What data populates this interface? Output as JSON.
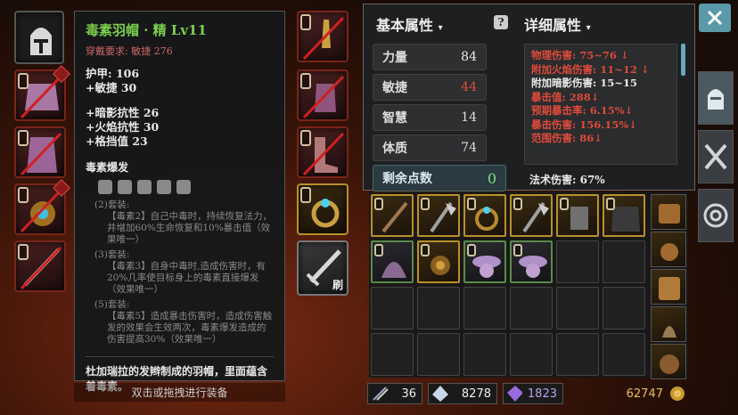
{
  "tooltip": {
    "title": "毒素羽帽 · 精 Lv11",
    "requirement": "穿戴要求: 敏捷 276",
    "armor": "护甲: 106",
    "agi_bonus": "+敏捷 30",
    "res_shadow": "+暗影抗性 26",
    "res_fire": "+火焰抗性 30",
    "block": "+格挡值 23",
    "set_name": "毒素爆发",
    "set2_head": "(2)套装:",
    "set2_text": "【毒素2】自己中毒时，持续恢复法力，并增加60%生命恢复和10%暴击值（效果唯一）",
    "set3_head": "(3)套装:",
    "set3_text": "【毒素3】自身中毒时,造成伤害时，有20%几率使目标身上的毒素直接爆发（效果唯一）",
    "set5_head": "(5)套装:",
    "set5_text": "【毒素5】造成暴击伤害时，造成伤害触发的效果会生效两次，毒素爆发造成的伤害提高30%（效果唯一）",
    "desc": "杜加瑞拉的发辫制成的羽帽，里面蕴含着毒素。",
    "hint": "双击或拖拽进行装备"
  },
  "weapon_slot_label": "刷",
  "basic": {
    "title": "基本属性",
    "rows": [
      {
        "label": "力量",
        "value": "84",
        "color": "#e8e8e8"
      },
      {
        "label": "敏捷",
        "value": "44",
        "color": "#e04a3a"
      },
      {
        "label": "智慧",
        "value": "14",
        "color": "#e8e8e8"
      },
      {
        "label": "体质",
        "value": "74",
        "color": "#e8e8e8"
      }
    ],
    "points_label": "剩余点数",
    "points_value": "0"
  },
  "detail": {
    "title": "详细属性",
    "lines": [
      {
        "text": "物理伤害: 75~76 ↓",
        "color": "red"
      },
      {
        "text": "附加火焰伤害: 11~12 ↓",
        "color": "red"
      },
      {
        "text": "附加暗影伤害: 15~15",
        "color": "white"
      },
      {
        "text": "暴击值: 288↓",
        "color": "red"
      },
      {
        "text": "预期暴击率: 6.15%↓",
        "color": "red"
      },
      {
        "text": "暴击伤害: 156.15%↓",
        "color": "red"
      },
      {
        "text": "范围伤害: 86↓",
        "color": "red"
      }
    ],
    "spell": "法术伤害: 67%"
  },
  "currency": {
    "arrows": "36",
    "shards": "8278",
    "gems": "1823",
    "gold": "62747"
  },
  "icons": [
    "helmet-icon",
    "close-icon",
    "crossed-swords-icon",
    "target-icon"
  ]
}
